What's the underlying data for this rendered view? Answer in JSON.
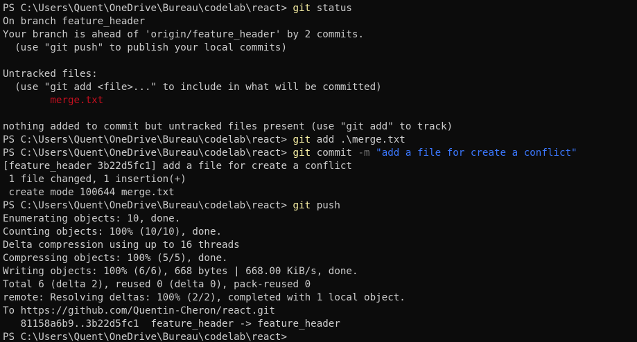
{
  "colors": {
    "background": "#0c0c0c",
    "foreground": "#cccccc",
    "command": "#f9f1a5",
    "parameter": "#767676",
    "string": "#3b78ff",
    "untracked": "#c50f1f"
  },
  "prompt": "PS C:\\Users\\Quent\\OneDrive\\Bureau\\codelab\\react> ",
  "lines": {
    "l1_cmd": "git",
    "l1_args": " status",
    "l2": "On branch feature_header",
    "l3": "Your branch is ahead of 'origin/feature_header' by 2 commits.",
    "l4": "  (use \"git push\" to publish your local commits)",
    "l6": "Untracked files:",
    "l7": "  (use \"git add <file>...\" to include in what will be committed)",
    "l8_indent": "        ",
    "l8_file": "merge.txt",
    "l10": "nothing added to commit but untracked files present (use \"git add\" to track)",
    "l11_cmd": "git",
    "l11_args": " add .\\merge.txt",
    "l12_cmd": "git",
    "l12_args": " commit ",
    "l12_flag": "-m",
    "l12_space": " ",
    "l12_msg": "\"add a file for create a conflict\"",
    "l13": "[feature_header 3b22d5fc1] add a file for create a conflict",
    "l14": " 1 file changed, 1 insertion(+)",
    "l15": " create mode 100644 merge.txt",
    "l16_cmd": "git",
    "l16_args": " push",
    "l17": "Enumerating objects: 10, done.",
    "l18": "Counting objects: 100% (10/10), done.",
    "l19": "Delta compression using up to 16 threads",
    "l20": "Compressing objects: 100% (5/5), done.",
    "l21": "Writing objects: 100% (6/6), 668 bytes | 668.00 KiB/s, done.",
    "l22": "Total 6 (delta 2), reused 0 (delta 0), pack-reused 0",
    "l23": "remote: Resolving deltas: 100% (2/2), completed with 1 local object.",
    "l24": "To https://github.com/Quentin-Cheron/react.git",
    "l25": "   81158a6b9..3b22d5fc1  feature_header -> feature_header"
  }
}
